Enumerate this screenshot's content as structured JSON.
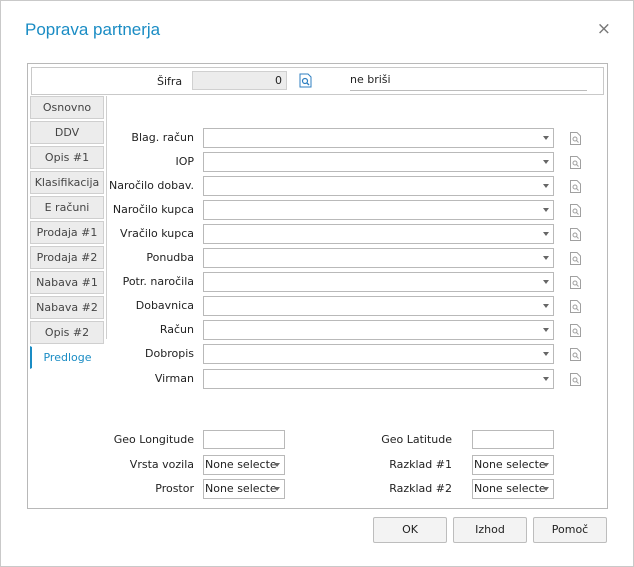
{
  "window": {
    "title": "Poprava partnerja",
    "close_label": "×"
  },
  "header": {
    "sifra_label": "Šifra",
    "sifra_value": "0",
    "nebrisi": "ne briši"
  },
  "tabs": [
    {
      "label": "Osnovno"
    },
    {
      "label": "DDV"
    },
    {
      "label": "Opis #1"
    },
    {
      "label": "Klasifikacija"
    },
    {
      "label": "E računi"
    },
    {
      "label": "Prodaja #1"
    },
    {
      "label": "Prodaja #2"
    },
    {
      "label": "Nabava #1"
    },
    {
      "label": "Nabava #2"
    },
    {
      "label": "Opis #2"
    },
    {
      "label": "Predloge"
    }
  ],
  "active_tab": "Predloge",
  "fields": [
    {
      "label": "Blag. račun",
      "value": ""
    },
    {
      "label": "IOP",
      "value": ""
    },
    {
      "label": "Naročilo dobav.",
      "value": ""
    },
    {
      "label": "Naročilo kupca",
      "value": ""
    },
    {
      "label": "Vračilo kupca",
      "value": ""
    },
    {
      "label": "Ponudba",
      "value": ""
    },
    {
      "label": "Potr. naročila",
      "value": ""
    },
    {
      "label": "Dobavnica",
      "value": ""
    },
    {
      "label": "Račun",
      "value": ""
    },
    {
      "label": "Dobropis",
      "value": ""
    },
    {
      "label": "Virman",
      "value": ""
    }
  ],
  "geo": {
    "longitude_label": "Geo Longitude",
    "longitude_value": "",
    "latitude_label": "Geo Latitude",
    "latitude_value": ""
  },
  "selects": {
    "vrsta_vozila_label": "Vrsta vozila",
    "vrsta_vozila_value": "None selected",
    "prostor_label": "Prostor",
    "prostor_value": "None selected",
    "razklad1_label": "Razklad #1",
    "razklad1_value": "None selected",
    "razklad2_label": "Razklad #2",
    "razklad2_value": "None selected"
  },
  "buttons": {
    "ok": "OK",
    "izhod": "Izhod",
    "pomoc": "Pomoč"
  },
  "colors": {
    "accent": "#1a8cc4"
  }
}
